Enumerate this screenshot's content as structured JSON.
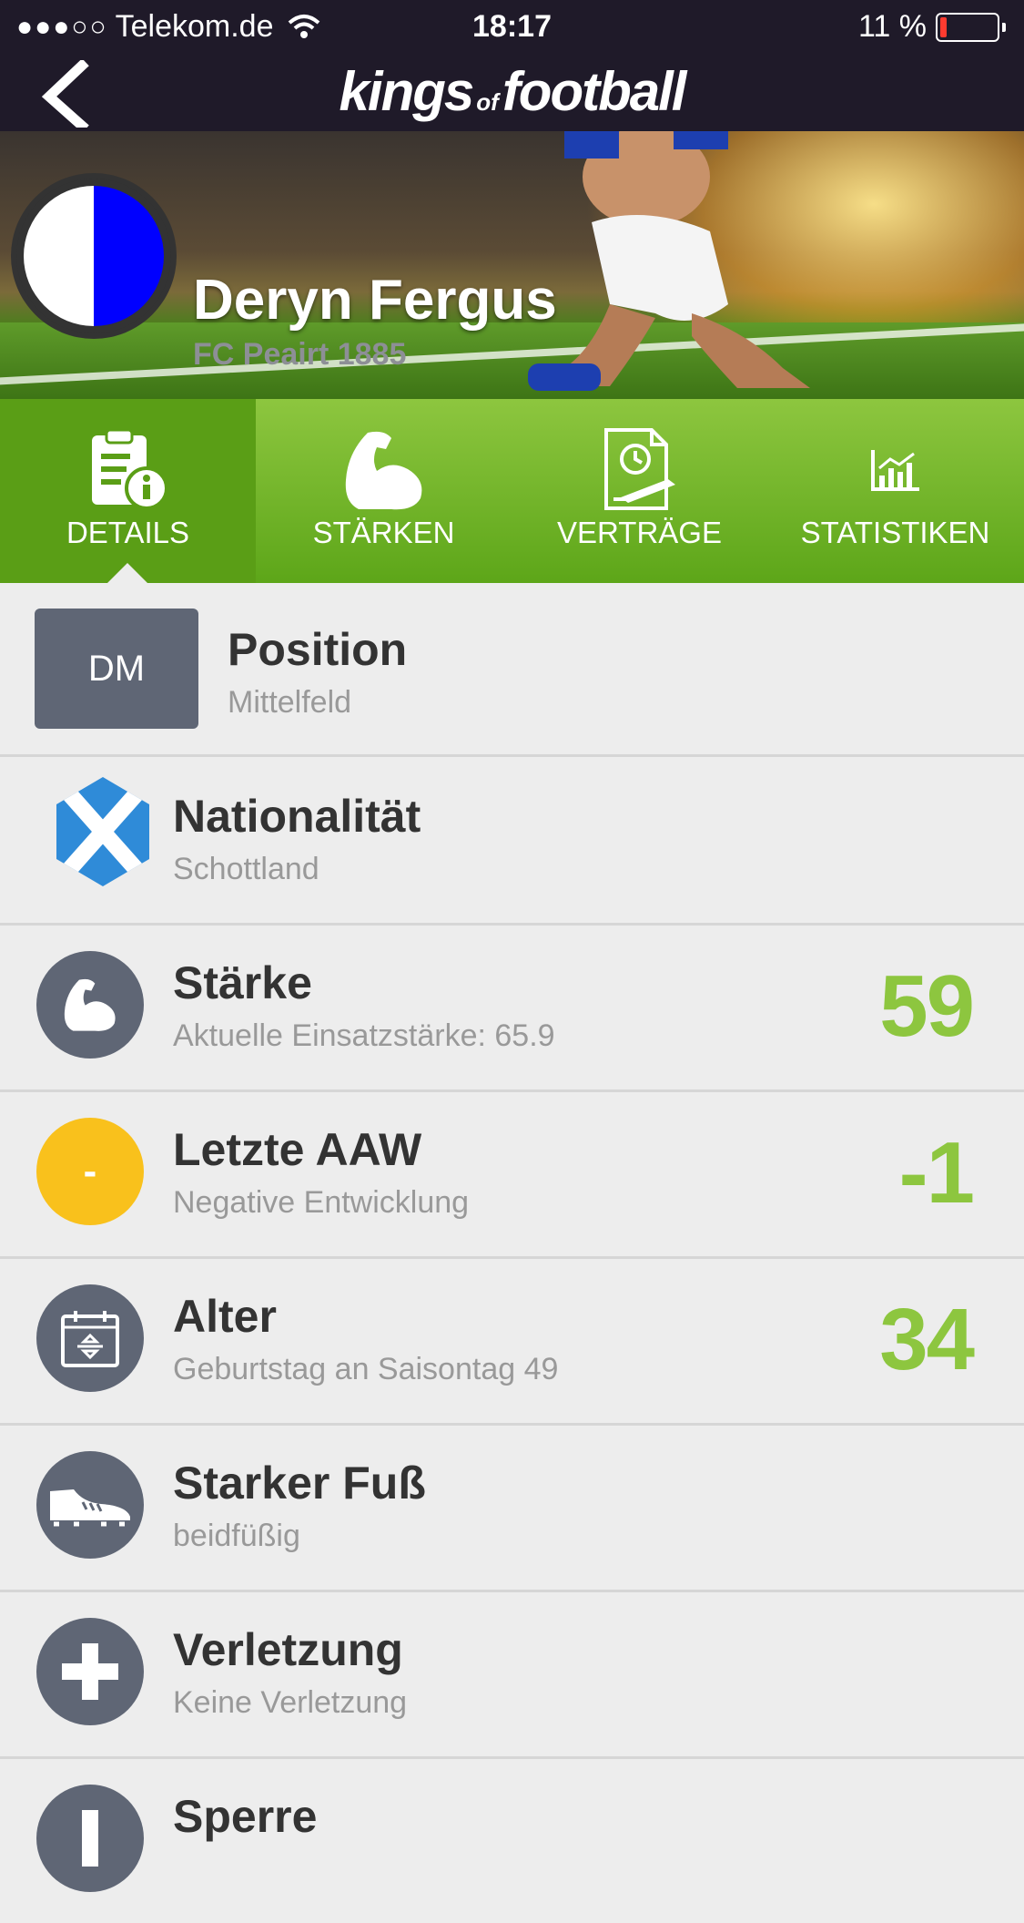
{
  "status_bar": {
    "carrier": "Telekom.de",
    "time": "18:17",
    "battery": "11 %",
    "battery_level": 0.11
  },
  "nav": {
    "logo_word1": "kings",
    "logo_word2": "of",
    "logo_word3": "football"
  },
  "player": {
    "name": "Deryn Fergus",
    "club": "FC Peairt 1885",
    "crest_colors": [
      "#ffffff",
      "#0000ff"
    ]
  },
  "tabs": [
    {
      "label": "DETAILS",
      "active": true
    },
    {
      "label": "STÄRKEN",
      "active": false
    },
    {
      "label": "VERTRÄGE",
      "active": false
    },
    {
      "label": "STATISTIKEN",
      "active": false
    }
  ],
  "details": {
    "position": {
      "badge": "DM",
      "title": "Position",
      "subtitle": "Mittelfeld"
    },
    "nationality": {
      "title": "Nationalität",
      "subtitle": "Schottland",
      "icon": "scotland-flag-icon"
    },
    "strength": {
      "title": "Stärke",
      "subtitle": "Aktuelle Einsatzstärke: 65.9",
      "value": "59",
      "icon": "bicep-icon"
    },
    "last_aaw": {
      "title": "Letzte AAW",
      "subtitle": "Negative Entwicklung",
      "value": "-1",
      "badge": "-",
      "color": "#f9c11c"
    },
    "age": {
      "title": "Alter",
      "subtitle": "Geburtstag an Saisontag 49",
      "value": "34",
      "icon": "calendar-icon"
    },
    "foot": {
      "title": "Starker Fuß",
      "subtitle": "beidfüßig",
      "icon": "boot-icon"
    },
    "injury": {
      "title": "Verletzung",
      "subtitle": "Keine Verletzung",
      "icon": "plus-icon"
    },
    "suspension": {
      "title": "Sperre"
    }
  },
  "colors": {
    "accent_green": "#8dc63f",
    "nav_bg": "#1f1a29",
    "icon_gray": "#5f6675"
  }
}
